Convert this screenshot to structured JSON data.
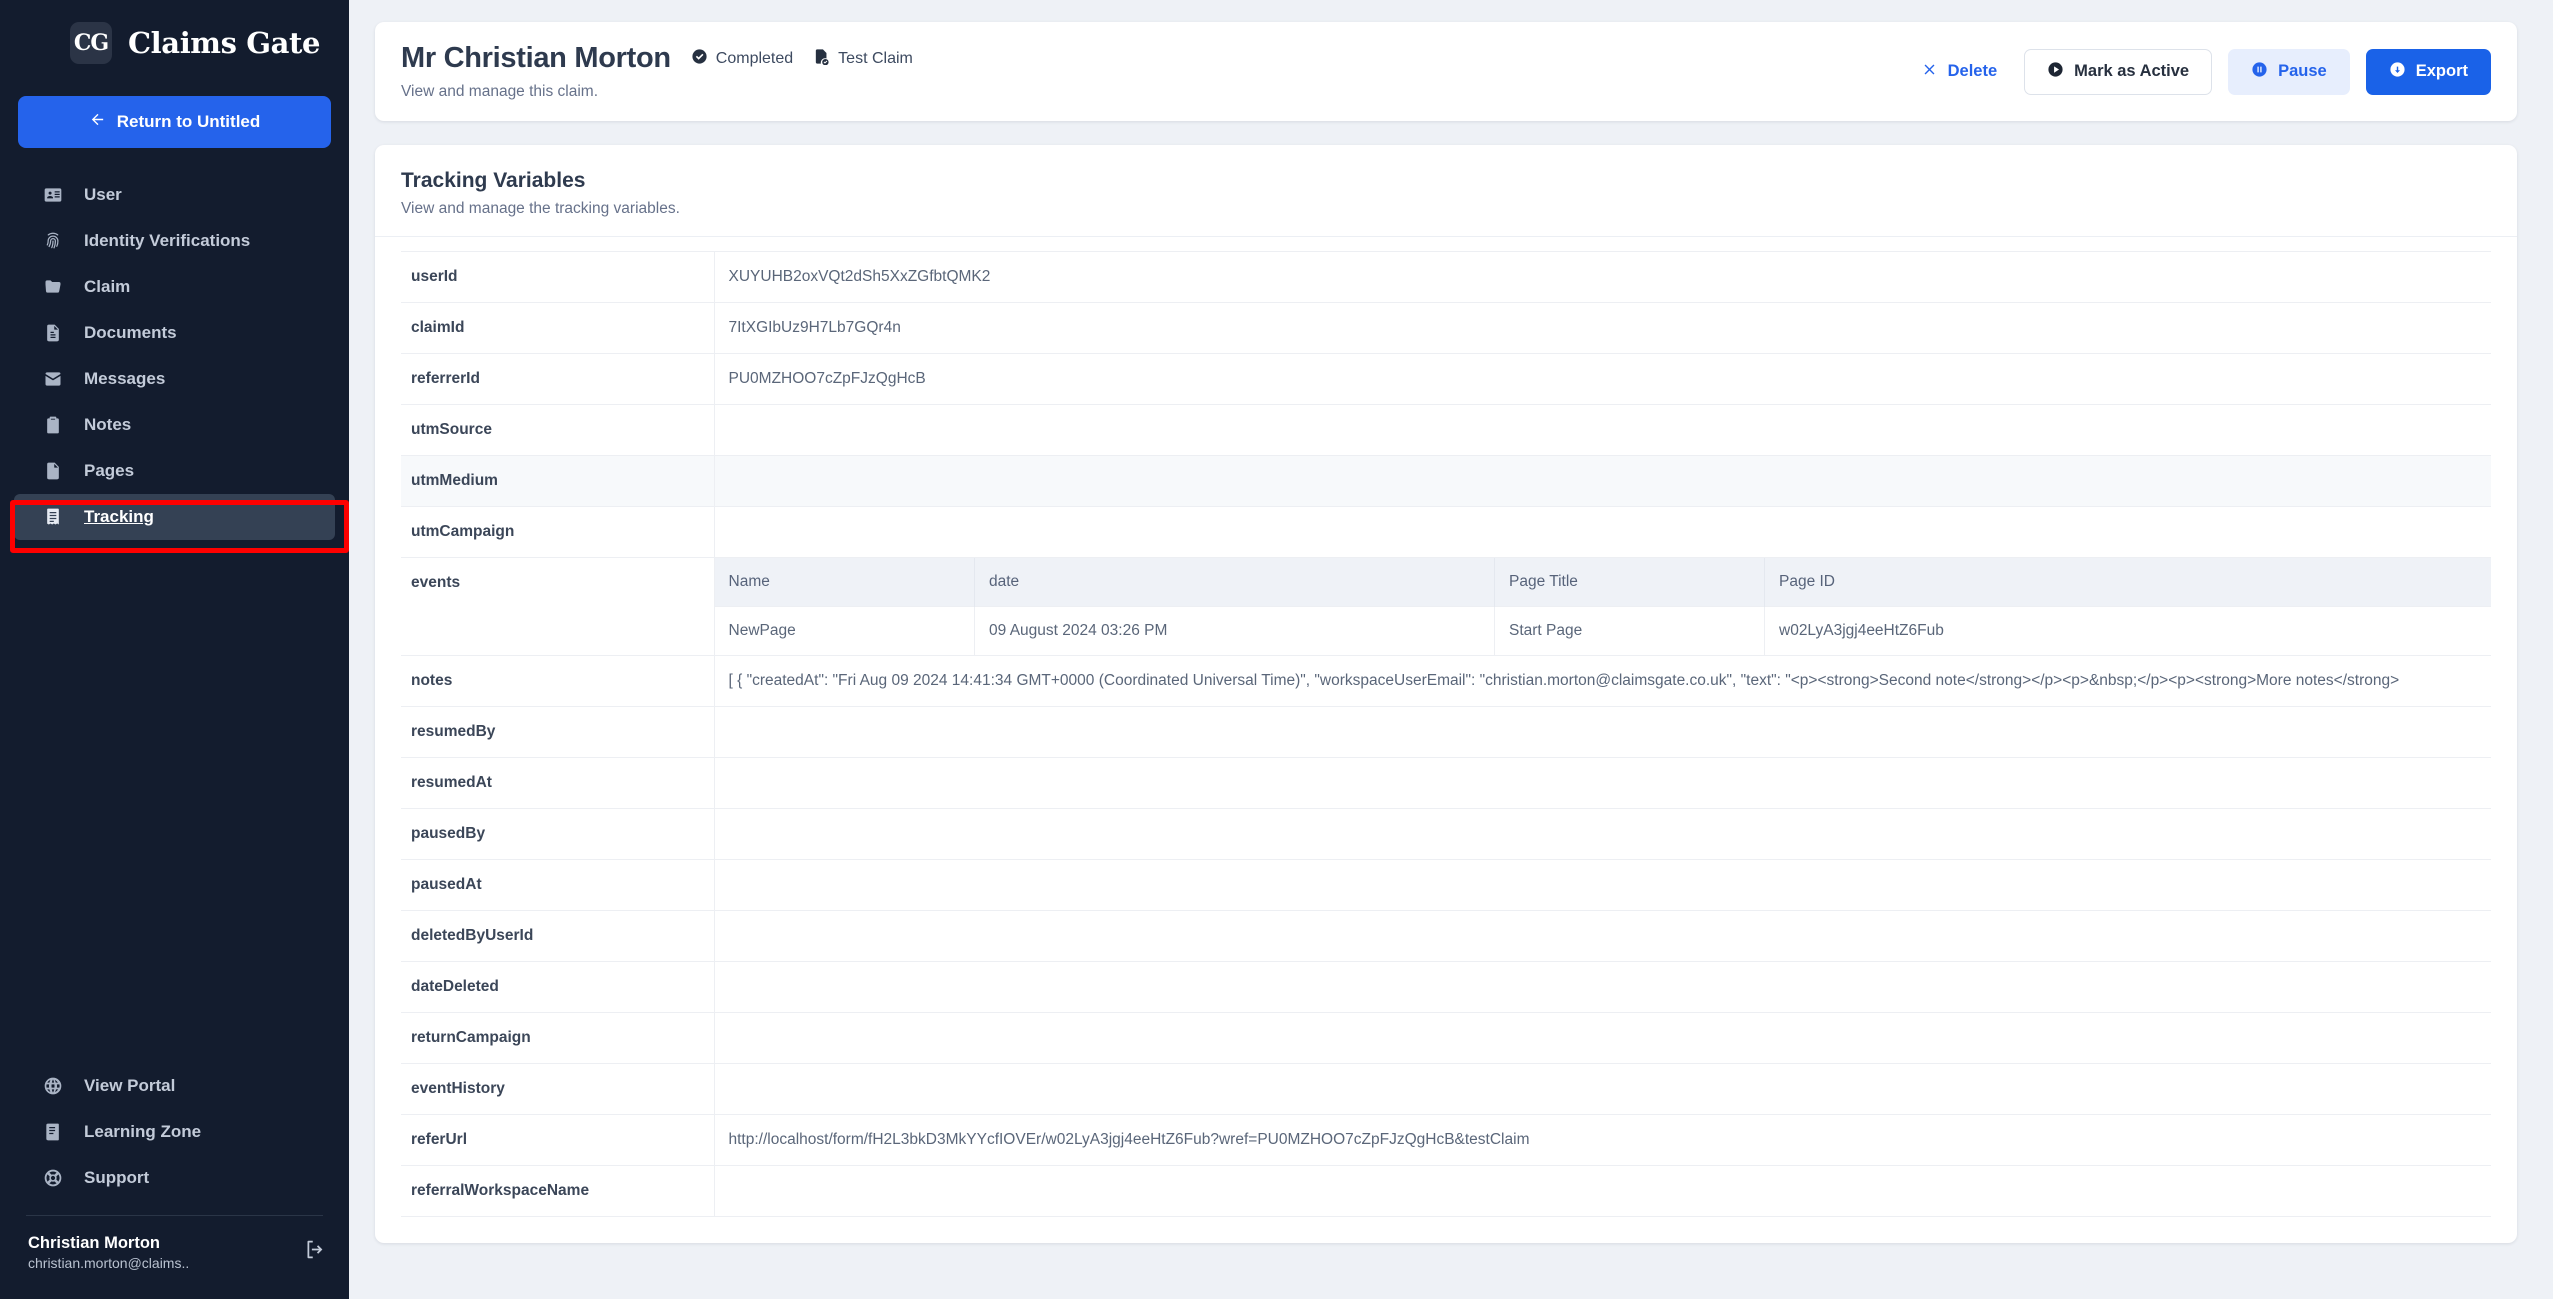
{
  "sidebar": {
    "brand": {
      "mark": "CG",
      "name": "Claims Gate"
    },
    "return_button": {
      "label": "Return to Untitled",
      "icon": "arrow-left-icon"
    },
    "items": [
      {
        "label": "User",
        "icon": "id-card-icon",
        "active": false
      },
      {
        "label": "Identity Verifications",
        "icon": "fingerprint-icon",
        "active": false
      },
      {
        "label": "Claim",
        "icon": "folder-icon",
        "active": false
      },
      {
        "label": "Documents",
        "icon": "document-icon",
        "active": false
      },
      {
        "label": "Messages",
        "icon": "envelope-icon",
        "active": false
      },
      {
        "label": "Notes",
        "icon": "clipboard-icon",
        "active": false
      },
      {
        "label": "Pages",
        "icon": "page-icon",
        "active": false
      },
      {
        "label": "Tracking",
        "icon": "receipt-icon",
        "active": true
      }
    ],
    "bottom_items": [
      {
        "label": "View Portal",
        "icon": "globe-icon"
      },
      {
        "label": "Learning Zone",
        "icon": "book-icon"
      },
      {
        "label": "Support",
        "icon": "lifebuoy-icon"
      }
    ],
    "user": {
      "name": "Christian Morton",
      "email": "christian.morton@claims..",
      "logout_icon": "logout-icon"
    }
  },
  "header": {
    "title": "Mr Christian Morton",
    "subtitle": "View and manage this claim.",
    "status_badge": {
      "label": "Completed",
      "icon": "check-circle-icon"
    },
    "type_badge": {
      "label": "Test Claim",
      "icon": "file-check-icon"
    },
    "actions": [
      {
        "label": "Delete",
        "icon": "close-icon",
        "style": "text"
      },
      {
        "label": "Mark as Active",
        "icon": "play-circle-icon",
        "style": "outline"
      },
      {
        "label": "Pause",
        "icon": "pause-circle-icon",
        "style": "soft"
      },
      {
        "label": "Export",
        "icon": "download-circle-icon",
        "style": "primary"
      }
    ]
  },
  "content": {
    "title": "Tracking Variables",
    "subtitle": "View and manage the tracking variables.",
    "rows": [
      {
        "key": "userId",
        "value": "XUYUHB2oxVQt2dSh5XxZGfbtQMK2"
      },
      {
        "key": "claimId",
        "value": "7ItXGIbUz9H7Lb7GQr4n"
      },
      {
        "key": "referrerId",
        "value": "PU0MZHOO7cZpFJzQgHcB"
      },
      {
        "key": "utmSource",
        "value": ""
      },
      {
        "key": "utmMedium",
        "value": ""
      },
      {
        "key": "utmCampaign",
        "value": ""
      },
      {
        "key": "notes",
        "value": "[ { \"createdAt\": \"Fri Aug 09 2024 14:41:34 GMT+0000 (Coordinated Universal Time)\", \"workspaceUserEmail\": \"christian.morton@claimsgate.co.uk\", \"text\": \"<p><strong>Second note</strong></p><p>&nbsp;</p><p><strong>More notes</strong>"
      },
      {
        "key": "resumedBy",
        "value": ""
      },
      {
        "key": "resumedAt",
        "value": ""
      },
      {
        "key": "pausedBy",
        "value": ""
      },
      {
        "key": "pausedAt",
        "value": ""
      },
      {
        "key": "deletedByUserId",
        "value": ""
      },
      {
        "key": "dateDeleted",
        "value": ""
      },
      {
        "key": "returnCampaign",
        "value": ""
      },
      {
        "key": "eventHistory",
        "value": ""
      },
      {
        "key": "referUrl",
        "value": "http://localhost/form/fH2L3bkD3MkYYcfIOVEr/w02LyA3jgj4eeHtZ6Fub?wref=PU0MZHOO7cZpFJzQgHcB&testClaim"
      },
      {
        "key": "referralWorkspaceName",
        "value": ""
      }
    ],
    "events_table": {
      "key": "events",
      "columns": [
        "Name",
        "date",
        "Page Title",
        "Page ID"
      ],
      "rows": [
        [
          "NewPage",
          "09 August 2024 03:26 PM",
          "Start Page",
          "w02LyA3jgj4eeHtZ6Fub"
        ]
      ]
    }
  },
  "colors": {
    "sidebar_bg": "#131c2e",
    "accent_blue": "#2563eb",
    "primary_button": "#1a62e8",
    "annotation_red": "#fe0000",
    "page_bg": "#eef1f6",
    "active_nav": "#344154"
  }
}
